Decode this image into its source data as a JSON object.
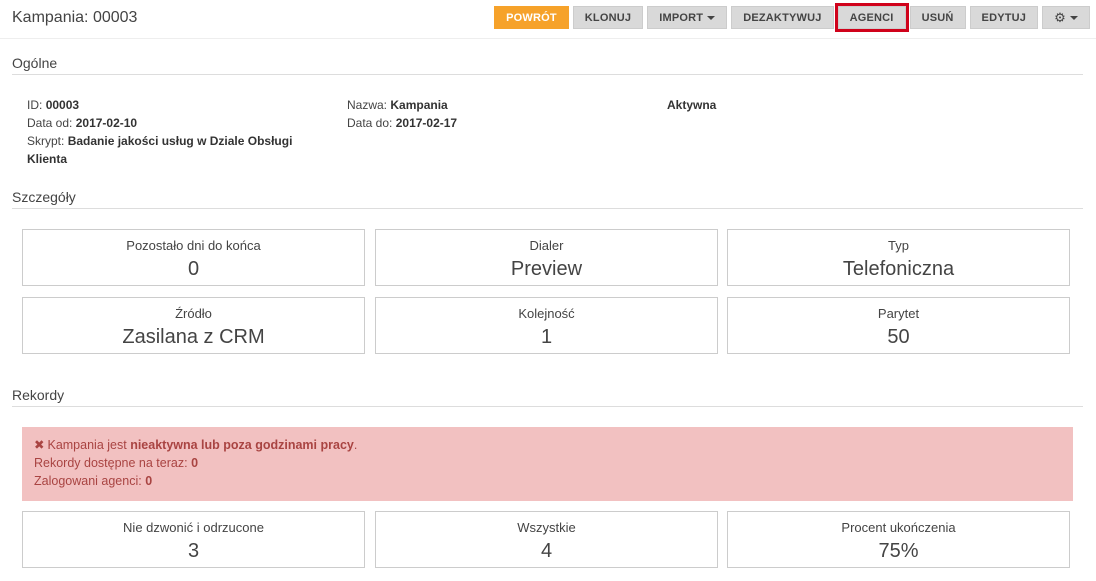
{
  "header": {
    "title": "Kampania: 00003",
    "buttons": {
      "back": "POWRÓT",
      "clone": "KLONUJ",
      "import": "IMPORT",
      "deactivate": "DEZAKTYWUJ",
      "agents": "AGENCI",
      "delete": "USUŃ",
      "edit": "EDYTUJ"
    },
    "settings_icon": "gear-icon"
  },
  "general": {
    "section_title": "Ogólne",
    "id_label": "ID:",
    "id_value": "00003",
    "date_from_label": "Data od:",
    "date_from_value": "2017-02-10",
    "script_label": "Skrypt:",
    "script_value": "Badanie jakości usług w Dziale Obsługi Klienta",
    "name_label": "Nazwa:",
    "name_value": "Kampania",
    "date_to_label": "Data do:",
    "date_to_value": "2017-02-17",
    "status": "Aktywna"
  },
  "details": {
    "section_title": "Szczegóły",
    "boxes": [
      {
        "label": "Pozostało dni do końca",
        "value": "0"
      },
      {
        "label": "Dialer",
        "value": "Preview"
      },
      {
        "label": "Typ",
        "value": "Telefoniczna"
      },
      {
        "label": "Źródło",
        "value": "Zasilana z CRM"
      },
      {
        "label": "Kolejność",
        "value": "1"
      },
      {
        "label": "Parytet",
        "value": "50"
      }
    ]
  },
  "records": {
    "section_title": "Rekordy",
    "alert": {
      "prefix": "Kampania jest",
      "emphasis": "nieaktywna lub poza godzinami pracy",
      "suffix": ".",
      "available_label": "Rekordy dostępne na teraz:",
      "available_value": "0",
      "agents_label": "Zalogowani agenci:",
      "agents_value": "0"
    },
    "boxes": [
      {
        "label": "Nie dzwonić i odrzucone",
        "value": "3"
      },
      {
        "label": "Wszystkie",
        "value": "4"
      },
      {
        "label": "Procent ukończenia",
        "value": "75%"
      }
    ]
  },
  "colors": {
    "primary_button": "#f6a22a",
    "alert_background": "#f2c1c1",
    "alert_text": "#a94442",
    "highlight_outline": "#d0021b"
  }
}
